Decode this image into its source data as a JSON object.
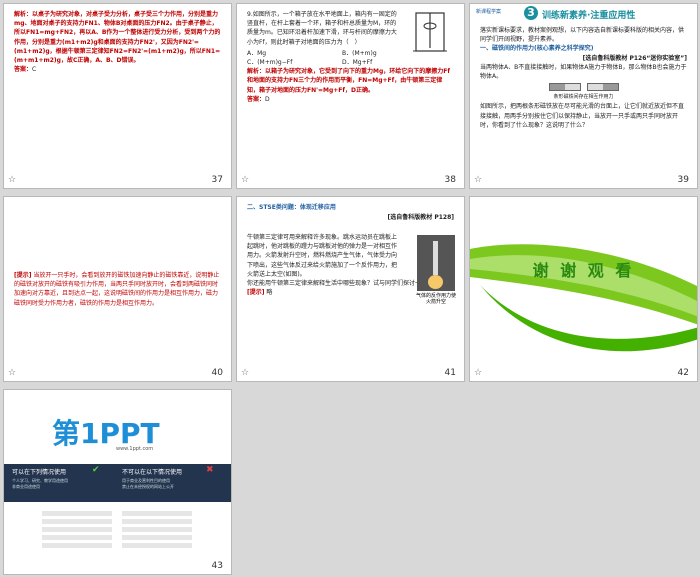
{
  "slides": {
    "s37": {
      "num": "37",
      "label": "答案：",
      "answer": "C",
      "text": "解析：以桌子为研究对象，对桌子受力分析，桌子受三个力作用，分别是重力mg、地面对桌子的支持力FN1、物体B对桌面的压力FN2。由于桌子静止，所以FN1=mg+FN2，再以A、B作为一个整体进行受力分析，受到两个力的作用，分别是重力(m1+m2)g和桌面的支持力FN2'，又因为FN2'=(m1+m2)g，根据牛顿第三定律知FN2=FN2'=(m1+m2)g，所以FN1=(m+m1+m2)g，故C正确，A、B、D错误。"
    },
    "s38": {
      "num": "38",
      "label": "答案：",
      "answer": "D",
      "question": "9.如图所示，一个箱子放在水平地面上，箱内有一固定的竖直杆，在杆上套着一个环，箱子和杆总质量为M，环的质量为m。已知环沿着杆加速下滑，环与杆间的摩擦力大小为Ff，则此时箱子对地面的压力为（　）",
      "opts": [
        "A．Mg",
        "B．(M+m)g",
        "C．(M+m)g−Ff",
        "D．Mg+Ff"
      ],
      "text": "解析：以箱子为研究对象，它受到了向下的重力Mg，环给它向下的摩擦力Ff和地面的支持力FN三个力的作用而平衡，FN=Mg+Ff，由牛顿第三定律知，箱子对地面的压力FN'=Mg+Ff，D正确。"
    },
    "s39": {
      "num": "39",
      "header_small": "新课程学案",
      "header_num": "3",
      "header_title": "训练新素养·注重应用性",
      "intro": "落实新课标要求，教材案例观想，以下内容选自新课标要科版的相关内容，供同学们开阔视野，提升素养。",
      "sub": "一、磁铁间的作用力(核心素养之科学探究)",
      "source": "[选自鲁科版教材 P126“迷你实验室”]",
      "p1": "当两物体A、B不直接接触时，如果物体A施力于物体B，那么物体B也会施力于物体A。",
      "caption": "条形磁铁间存在相互作用力",
      "p2": "如图所示，把两根条形磁铁放在尽可能光滑的台面上，让它们就近放近但不直接接触，用两手分别按住它们以保持静止，当放开一只手或两只手同时放开时，你看到了什么现象？这说明了什么？"
    },
    "s40": {
      "num": "40",
      "label": "[提示]",
      "text": "当放开一只手时，会看到放开的磁铁加速向静止的磁铁靠近，说明静止的磁铁对放开的磁铁有吸引力作用，当两只手同时放开时，会看到两磁铁同时加速向对方靠近，且到达点一起，这说明磁铁间的作用力是相互作用力，磁力磁铁同时受力作用力者，磁铁的作用力是相互作用力。"
    },
    "s41": {
      "num": "41",
      "section": "二、STSE类问题：体现迁移应用",
      "source": "[选自鲁科版教材 P128]",
      "text": "牛顿第三定律可用来解释许多现象。跳水运动员在跳板上起跳时，他对跳板的蹬力与跳板对他的弹力是一对相互作用力。火箭发射升空时，燃料燃烧产生气体，气体受力向下喷出，这些气体反过来给火箭施加了一个反作用力，把火箭送上太空(如图)。",
      "caption": "气体的反作用力使火箭升空",
      "q": "你还能用牛顿第三定律来解释生活中哪些现象？试与同学们探讨一下。",
      "label": "[提示]",
      "answer": "略"
    },
    "s42": {
      "num": "42",
      "thanks": "谢 谢 观 看"
    },
    "s43": {
      "num": "43",
      "logo_text": "第1PPT",
      "url": "www.1ppt.com",
      "can_title": "可以在下列情况使用",
      "cannot_title": "不可以在以下情况使用",
      "can": [
        "个人学习、研究、教学用途使用",
        "非商业用途使用"
      ],
      "cannot": [
        "用于商业及营利性目的使用",
        "禁止在未经授权的网站上公开"
      ]
    }
  },
  "star": "☆",
  "colors": {
    "red": "#c00000",
    "blue": "#2060a0",
    "green": "#44b000",
    "teal": "#1a8fa0",
    "logo_blue": "#1e8fd6",
    "navy": "#23344f"
  }
}
